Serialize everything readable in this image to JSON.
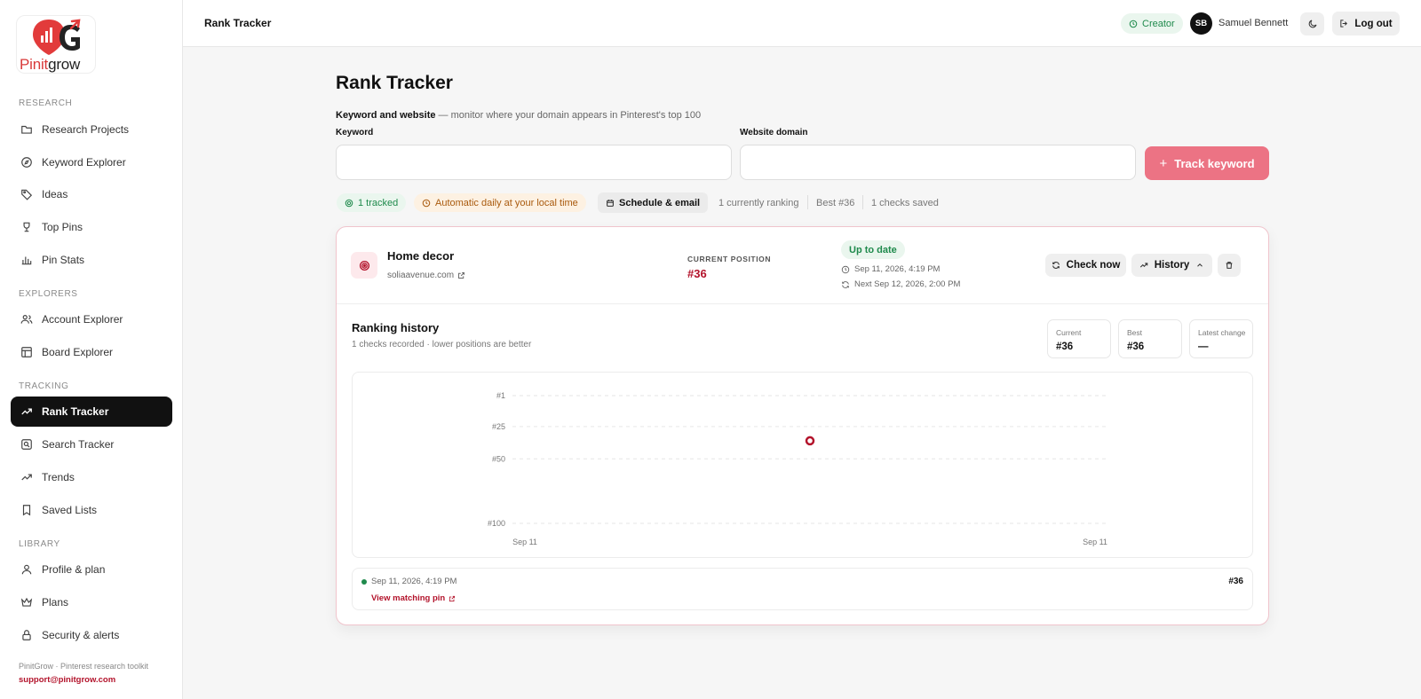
{
  "app": {
    "logo_text_a": "Pinit",
    "logo_text_b": "grow",
    "footer": "PinitGrow · Pinterest research toolkit",
    "support_email": "support@pinitgrow.com"
  },
  "sidebar": {
    "sections": [
      {
        "label": "RESEARCH"
      },
      {
        "label": "EXPLORERS"
      },
      {
        "label": "TRACKING"
      },
      {
        "label": "LIBRARY"
      }
    ],
    "items": [
      {
        "label": "Research Projects",
        "icon": "folder-icon"
      },
      {
        "label": "Keyword Explorer",
        "icon": "compass-icon"
      },
      {
        "label": "Ideas",
        "icon": "tag-icon"
      },
      {
        "label": "Top Pins",
        "icon": "trophy-icon"
      },
      {
        "label": "Pin Stats",
        "icon": "bar-chart-icon"
      },
      {
        "label": "Account Explorer",
        "icon": "users-icon"
      },
      {
        "label": "Board Explorer",
        "icon": "layout-icon"
      },
      {
        "label": "Rank Tracker",
        "icon": "trending-up-icon",
        "active": true
      },
      {
        "label": "Search Tracker",
        "icon": "search-square-icon"
      },
      {
        "label": "Trends",
        "icon": "trending-up-icon"
      },
      {
        "label": "Saved Lists",
        "icon": "bookmark-icon"
      },
      {
        "label": "Profile & plan",
        "icon": "user-icon"
      },
      {
        "label": "Plans",
        "icon": "crown-icon"
      },
      {
        "label": "Security & alerts",
        "icon": "lock-icon"
      }
    ]
  },
  "topbar": {
    "title": "Rank Tracker",
    "plan": "Creator",
    "avatar_initials": "SB",
    "username": "Samuel Bennett",
    "logout": "Log out"
  },
  "main": {
    "title": "Rank Tracker",
    "form_heading": "Keyword and website",
    "form_desc": " — monitor where your domain appears in Pinterest's top 100",
    "keyword_label": "Keyword",
    "keyword_value": "",
    "domain_label": "Website domain",
    "domain_value": "",
    "track_button": "Track keyword",
    "chips": {
      "tracked": "1 tracked",
      "schedule": "Automatic daily at your local time",
      "schedule_email": "Schedule & email"
    },
    "stats": {
      "ranking": "1 currently ranking",
      "best": "Best #36",
      "checks": "1 checks saved"
    }
  },
  "card": {
    "keyword": "Home decor",
    "domain": "soliaavenue.com",
    "current_label": "CURRENT POSITION",
    "current_value": "#36",
    "status": "Up to date",
    "last_checked": "Sep 11, 2026, 4:19 PM",
    "next_check": "Next Sep 12, 2026, 2:00 PM",
    "check_now": "Check now",
    "history": "History",
    "history_title": "Ranking history",
    "history_sub": "1 checks recorded · lower positions are better",
    "mini": [
      {
        "label": "Current",
        "value": "#36"
      },
      {
        "label": "Best",
        "value": "#36"
      },
      {
        "label": "Latest change",
        "value": "—"
      }
    ],
    "row": {
      "date": "Sep 11, 2026, 4:19 PM",
      "link": "View matching pin",
      "position": "#36"
    }
  },
  "colors": {
    "accent": "#b3132b",
    "button": "#ec7384",
    "success": "#1f8a4c"
  },
  "chart_data": {
    "type": "scatter",
    "title": "",
    "xlabel": "",
    "ylabel": "",
    "y_ticks": [
      "#1",
      "#25",
      "#50",
      "#100"
    ],
    "y_tick_values": [
      1,
      25,
      50,
      100
    ],
    "ylim": [
      1,
      100
    ],
    "y_inverted": true,
    "x_ticks": [
      "Sep 11",
      "Sep 11"
    ],
    "series": [
      {
        "x": [
          "Sep 11, 2026, 4:19 PM"
        ],
        "values": [
          36
        ]
      }
    ],
    "grid": true
  }
}
